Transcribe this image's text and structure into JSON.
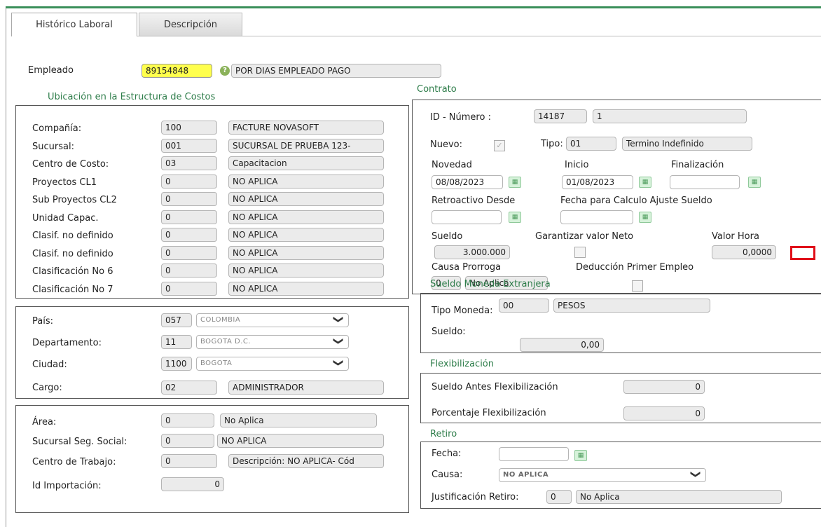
{
  "tabs": {
    "historico": "Histórico Laboral",
    "descripcion": "Descripción"
  },
  "empleado": {
    "label": "Empleado",
    "code": "89154848",
    "name": "POR DIAS EMPLEADO PAGO"
  },
  "ubicacion": {
    "title": "Ubicación en la Estructura de Costos",
    "rows": [
      {
        "label": "Compañía:",
        "code": "100",
        "desc": "FACTURE NOVASOFT"
      },
      {
        "label": "Sucursal:",
        "code": "001",
        "desc": "SUCURSAL DE PRUEBA 123-"
      },
      {
        "label": "Centro de Costo:",
        "code": "03",
        "desc": "Capacitacion"
      },
      {
        "label": "Proyectos CL1",
        "code": "0",
        "desc": "NO APLICA"
      },
      {
        "label": "Sub Proyectos CL2",
        "code": "0",
        "desc": "NO APLICA"
      },
      {
        "label": "Unidad Capac.",
        "code": "0",
        "desc": "NO APLICA"
      },
      {
        "label": "Clasif. no definido",
        "code": "0",
        "desc": "NO APLICA"
      },
      {
        "label": "Clasif. no definido",
        "code": "0",
        "desc": "NO APLICA"
      },
      {
        "label": "Clasificación No 6",
        "code": "0",
        "desc": "NO APLICA"
      },
      {
        "label": "Clasificación No 7",
        "code": "0",
        "desc": "NO APLICA"
      }
    ]
  },
  "geo": {
    "pais": {
      "label": "País:",
      "code": "057",
      "value": "COLOMBIA"
    },
    "departamento": {
      "label": "Departamento:",
      "code": "11",
      "value": "BOGOTA D.C."
    },
    "ciudad": {
      "label": "Ciudad:",
      "code": "1100",
      "value": "BOGOTA"
    },
    "cargo": {
      "label": "Cargo:",
      "code": "02",
      "value": "ADMINISTRADOR"
    }
  },
  "area_box": {
    "area": {
      "label": "Área:",
      "code": "0",
      "value": "No Aplica"
    },
    "sucursal_ss": {
      "label": "Sucursal Seg. Social:",
      "code": "0",
      "value": "NO APLICA"
    },
    "centro_trabajo": {
      "label": "Centro de Trabajo:",
      "code": "0",
      "value": "Descripción: NO APLICA- Cód"
    },
    "id_importacion": {
      "label": "Id Importación:",
      "value": "0"
    }
  },
  "contrato": {
    "title": "Contrato",
    "id_label": "ID - Número :",
    "id": "14187",
    "numero": "1",
    "nuevo_label": "Nuevo:",
    "tipo_label": "Tipo:",
    "tipo_code": "01",
    "tipo_desc": "Termino Indefinido",
    "novedad_label": "Novedad",
    "novedad": "08/08/2023",
    "inicio_label": "Inicio",
    "inicio": "01/08/2023",
    "finalizacion_label": "Finalización",
    "finalizacion": "",
    "retro_label": "Retroactivo Desde",
    "fecha_calc_label": "Fecha para Calculo Ajuste Sueldo",
    "sueldo_label": "Sueldo",
    "sueldo": "3.000.000",
    "garantizar_label": "Garantizar valor Neto",
    "valor_hora_label": "Valor Hora",
    "valor_hora": "0,0000",
    "causa_label": "Causa Prorroga",
    "causa_code": "0",
    "causa_desc": "No Aplica",
    "deduccion_label": "Deducción Primer Empleo"
  },
  "moneda": {
    "title": "Sueldo Moneda Extranjera",
    "tipo_label": "Tipo Moneda:",
    "tipo_code": "00",
    "tipo_desc": "PESOS",
    "sueldo_label": "Sueldo:",
    "sueldo": "0,00"
  },
  "flex": {
    "title": "Flexibilización",
    "antes_label": "Sueldo Antes Flexibilización",
    "antes": "0",
    "pct_label": "Porcentaje Flexibilización",
    "pct": "0"
  },
  "retiro": {
    "title": "Retiro",
    "fecha_label": "Fecha:",
    "fecha": "",
    "causa_label": "Causa:",
    "causa": "NO APLICA",
    "just_label": "Justificación Retiro:",
    "just_code": "0",
    "just_desc": "No Aplica"
  },
  "icons": {
    "calendar": "calendar-icon",
    "chevron": "chevron-down-icon",
    "info": "info-icon"
  }
}
